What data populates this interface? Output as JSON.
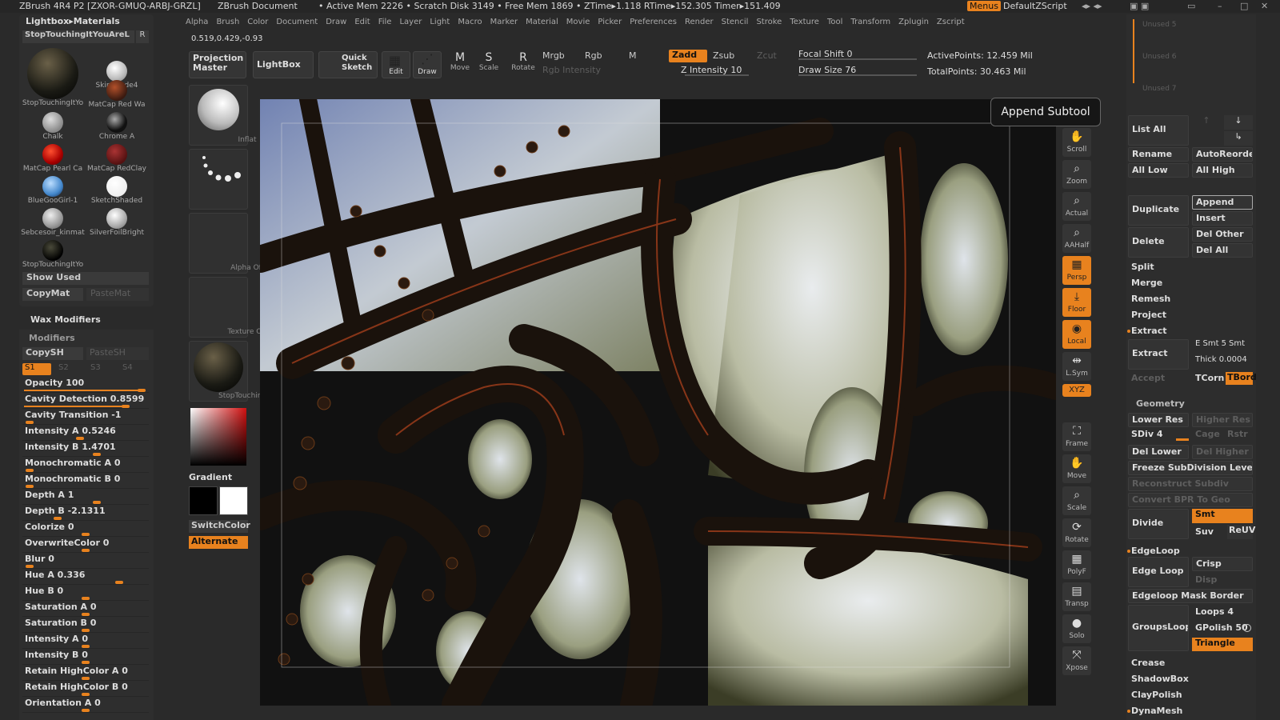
{
  "titlebar": {
    "app": "ZBrush 4R4 P2 [ZXOR-GMUQ-ARBJ-GRZL]",
    "doc": "ZBrush Document",
    "stats": "• Active Mem 2226 • Scratch Disk 3149 • Free Mem 1869 • ZTime▸1.118 RTime▸152.305 Timer▸151.409",
    "menus_btn": "Menus",
    "script": "DefaultZScript"
  },
  "menu": [
    "Alpha",
    "Brush",
    "Color",
    "Document",
    "Draw",
    "Edit",
    "File",
    "Layer",
    "Light",
    "Macro",
    "Marker",
    "Material",
    "Movie",
    "Picker",
    "Preferences",
    "Render",
    "Stencil",
    "Stroke",
    "Texture",
    "Tool",
    "Transform",
    "Zplugin",
    "Zscript"
  ],
  "coords": "0.519,0.429,-0.93",
  "toolbar": {
    "projection": "Projection Master",
    "lightbox": "LightBox",
    "quicksketch": "Quick Sketch",
    "edit": "Edit",
    "draw": "Draw",
    "move": "Move",
    "scale": "Scale",
    "rotate": "Rotate",
    "mrgb": "Mrgb",
    "rgb": "Rgb",
    "m": "M",
    "rgb_intensity": "Rgb Intensity",
    "zadd": "Zadd",
    "zsub": "Zsub",
    "zcut": "Zcut",
    "z_intensity": "Z Intensity 10",
    "focal_shift": "Focal Shift 0",
    "draw_size": "Draw Size 76",
    "active_points": "ActivePoints: 12.459 Mil",
    "total_points": "TotalPoints: 30.463 Mil"
  },
  "leftpanel": {
    "header": "Lightbox▸Materials",
    "current": "StopTouchingItYouAreL",
    "r_btn": "R",
    "materials": [
      "StopTouchingItYo",
      "SkinShade4",
      "MatCap Red Wa",
      "Chalk",
      "Chrome A",
      "MatCap Pearl Ca",
      "MatCap RedClay",
      "BlueGooGirl-1",
      "SketchShaded",
      "Sebcesoir_kinmat",
      "SilverFoilBright",
      "StopTouchingItYo"
    ],
    "show_used": "Show Used",
    "copymat": "CopyMat",
    "pastemat": "PasteMat"
  },
  "wax": "Wax Modifiers",
  "modifiers": {
    "header": "Modifiers",
    "copysh": "CopySH",
    "pastesh": "PasteSH",
    "tabs": [
      "S1",
      "S2",
      "S3",
      "S4"
    ],
    "sliders": [
      {
        "label": "Opacity 100",
        "frac": 1.0
      },
      {
        "label": "Cavity Detection 0.8599",
        "frac": 0.86
      },
      {
        "label": "Cavity Transition -1",
        "frac": 0.0
      },
      {
        "label": "Intensity A 0.5246",
        "frac": 0.45
      },
      {
        "label": "Intensity B 1.4701",
        "frac": 0.6
      },
      {
        "label": "Monochromatic A 0",
        "frac": 0.0
      },
      {
        "label": "Monochromatic B 0",
        "frac": 0.0
      },
      {
        "label": "Depth A 1",
        "frac": 0.6
      },
      {
        "label": "Depth B -2.1311",
        "frac": 0.25
      },
      {
        "label": "Colorize 0",
        "frac": 0.5
      },
      {
        "label": "OverwriteColor 0",
        "frac": 0.5
      },
      {
        "label": "Blur 0",
        "frac": 0.0
      },
      {
        "label": "Hue A 0.336",
        "frac": 0.8
      },
      {
        "label": "Hue B 0",
        "frac": 0.5
      },
      {
        "label": "Saturation A 0",
        "frac": 0.5
      },
      {
        "label": "Saturation B 0",
        "frac": 0.5
      },
      {
        "label": "Intensity A 0",
        "frac": 0.5
      },
      {
        "label": "Intensity B 0",
        "frac": 0.5
      },
      {
        "label": "Retain HighColor A 0",
        "frac": 0.5
      },
      {
        "label": "Retain HighColor B 0",
        "frac": 0.5
      },
      {
        "label": "Orientation A 0",
        "frac": 0.5
      }
    ]
  },
  "brushcol": {
    "inflat": "Inflat",
    "dots": "Dots",
    "alpha": "Alpha Off",
    "texture": "Texture Off",
    "material": "StopTouchingItYo",
    "gradient": "Gradient",
    "switchcolor": "SwitchColor",
    "alternate": "Alternate"
  },
  "tooltip": "Append Subtool",
  "righttools": [
    "Scroll",
    "Zoom",
    "Actual",
    "AAHalf",
    "Persp",
    "Floor",
    "Local",
    "L.Sym",
    "XYZ",
    "Frame",
    "Move",
    "Scale",
    "Rotate",
    "PolyF",
    "Transp",
    "Solo",
    "Xpose"
  ],
  "subtool": {
    "unused": [
      "Unused 5",
      "Unused 6",
      "Unused 7"
    ],
    "listall": "List All",
    "rename": "Rename",
    "autoreorder": "AutoReorder",
    "alllow": "All Low",
    "allhigh": "All High",
    "duplicate": "Duplicate",
    "append": "Append",
    "insert": "Insert",
    "delete": "Delete",
    "delother": "Del Other",
    "delall": "Del All",
    "split": "Split",
    "merge": "Merge",
    "remesh": "Remesh",
    "project": "Project",
    "extract_h": "Extract",
    "extract": "Extract",
    "esmt": "E Smt 5",
    "smt": "Smt",
    "thick": "Thick 0.0004",
    "accept": "Accept",
    "tcorn": "TCorn",
    "tbord": "TBord"
  },
  "geometry": {
    "header": "Geometry",
    "lowerres": "Lower Res",
    "higherres": "Higher Res",
    "sdiv": "SDiv 4",
    "cage": "Cage",
    "rstr": "Rstr",
    "dellower": "Del Lower",
    "delhigher": "Del Higher",
    "freeze": "Freeze SubDivision Levels",
    "reconstruct": "Reconstruct Subdiv",
    "convert": "Convert BPR To Geo",
    "divide": "Divide",
    "smt": "Smt",
    "suv": "Suv",
    "reuv": "ReUV",
    "edgeloop_h": "EdgeLoop",
    "edgeloop": "Edge Loop",
    "crisp": "Crisp",
    "disp": "Disp",
    "edgeloopmask": "Edgeloop Mask Border",
    "groupsloops": "GroupsLoops",
    "loops": "Loops 4",
    "gpolish": "GPolish 50",
    "triangle": "Triangle",
    "crease": "Crease",
    "shadowbox": "ShadowBox",
    "claypolish": "ClayPolish",
    "dynamesh": "DynaMesh"
  },
  "colors": {
    "accent": "#e8821e",
    "panel": "#2e2e2e"
  }
}
